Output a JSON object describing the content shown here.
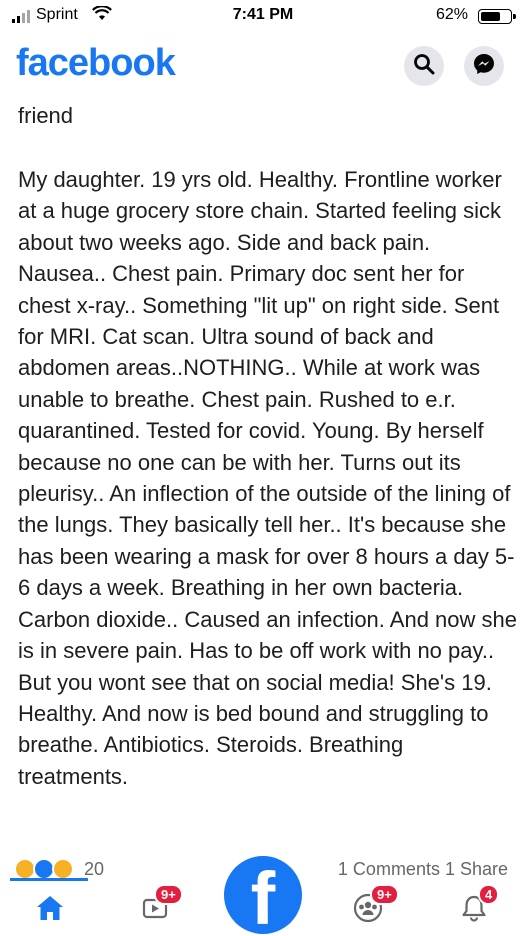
{
  "status_bar": {
    "carrier": "Sprint",
    "time": "7:41 PM",
    "battery": "62%",
    "battery_level": 0.62
  },
  "header": {
    "brand": "facebook",
    "search_icon": "search-icon",
    "messenger_icon": "messenger-icon"
  },
  "post": {
    "author": "friend",
    "text": "My daughter. 19 yrs old. Healthy. Frontline worker at a huge grocery store chain. Started feeling sick about two weeks ago. Side and back pain. Nausea.. Chest pain. Primary doc sent her for chest x-ray.. Something \"lit up\" on right side. Sent for MRI. Cat scan. Ultra sound of back and abdomen areas..NOTHING.. While at work was unable to breathe. Chest pain. Rushed to e.r. quarantined. Tested for covid. Young. By herself because no one can be with her. Turns out its pleurisy.. An inflection of the outside of the lining of the lungs. They basically tell her.. It's because she has been wearing a mask for over 8 hours a day 5-6 days a week. Breathing in her own bacteria. Carbon dioxide.. Caused an infection. And now she is in severe pain. Has to be off work with no pay.. But you wont see that on social media! She's 19. Healthy. And now is bed bound and struggling to breathe. Antibiotics. Steroids. Breathing treatments.",
    "reaction_count": "20",
    "comments_shares": "1 Comments  1 Share"
  },
  "nav": {
    "watch_badge": "9+",
    "groups_badge": "9+",
    "notifications_badge": "4"
  },
  "colors": {
    "brand_blue": "#1877f2",
    "badge_red": "#e41e3f",
    "icon_bg": "#e4e6eb"
  }
}
